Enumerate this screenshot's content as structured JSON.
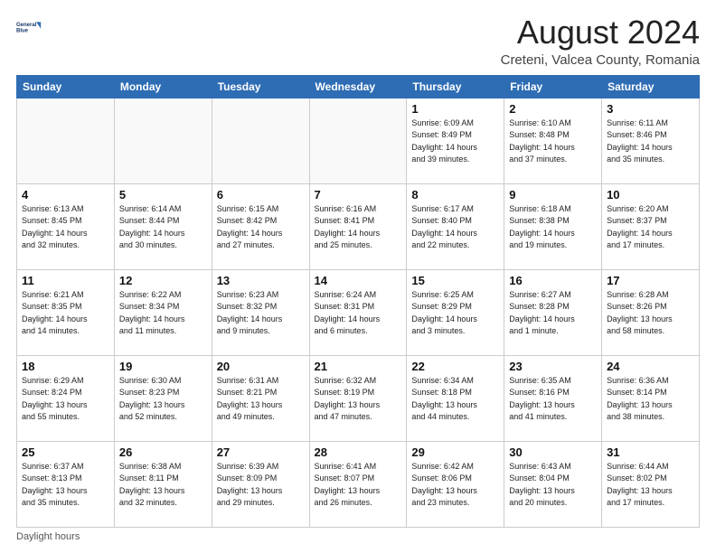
{
  "logo": {
    "line1": "General",
    "line2": "Blue"
  },
  "title": "August 2024",
  "subtitle": "Creteni, Valcea County, Romania",
  "weekdays": [
    "Sunday",
    "Monday",
    "Tuesday",
    "Wednesday",
    "Thursday",
    "Friday",
    "Saturday"
  ],
  "weeks": [
    [
      {
        "day": "",
        "info": ""
      },
      {
        "day": "",
        "info": ""
      },
      {
        "day": "",
        "info": ""
      },
      {
        "day": "",
        "info": ""
      },
      {
        "day": "1",
        "info": "Sunrise: 6:09 AM\nSunset: 8:49 PM\nDaylight: 14 hours\nand 39 minutes."
      },
      {
        "day": "2",
        "info": "Sunrise: 6:10 AM\nSunset: 8:48 PM\nDaylight: 14 hours\nand 37 minutes."
      },
      {
        "day": "3",
        "info": "Sunrise: 6:11 AM\nSunset: 8:46 PM\nDaylight: 14 hours\nand 35 minutes."
      }
    ],
    [
      {
        "day": "4",
        "info": "Sunrise: 6:13 AM\nSunset: 8:45 PM\nDaylight: 14 hours\nand 32 minutes."
      },
      {
        "day": "5",
        "info": "Sunrise: 6:14 AM\nSunset: 8:44 PM\nDaylight: 14 hours\nand 30 minutes."
      },
      {
        "day": "6",
        "info": "Sunrise: 6:15 AM\nSunset: 8:42 PM\nDaylight: 14 hours\nand 27 minutes."
      },
      {
        "day": "7",
        "info": "Sunrise: 6:16 AM\nSunset: 8:41 PM\nDaylight: 14 hours\nand 25 minutes."
      },
      {
        "day": "8",
        "info": "Sunrise: 6:17 AM\nSunset: 8:40 PM\nDaylight: 14 hours\nand 22 minutes."
      },
      {
        "day": "9",
        "info": "Sunrise: 6:18 AM\nSunset: 8:38 PM\nDaylight: 14 hours\nand 19 minutes."
      },
      {
        "day": "10",
        "info": "Sunrise: 6:20 AM\nSunset: 8:37 PM\nDaylight: 14 hours\nand 17 minutes."
      }
    ],
    [
      {
        "day": "11",
        "info": "Sunrise: 6:21 AM\nSunset: 8:35 PM\nDaylight: 14 hours\nand 14 minutes."
      },
      {
        "day": "12",
        "info": "Sunrise: 6:22 AM\nSunset: 8:34 PM\nDaylight: 14 hours\nand 11 minutes."
      },
      {
        "day": "13",
        "info": "Sunrise: 6:23 AM\nSunset: 8:32 PM\nDaylight: 14 hours\nand 9 minutes."
      },
      {
        "day": "14",
        "info": "Sunrise: 6:24 AM\nSunset: 8:31 PM\nDaylight: 14 hours\nand 6 minutes."
      },
      {
        "day": "15",
        "info": "Sunrise: 6:25 AM\nSunset: 8:29 PM\nDaylight: 14 hours\nand 3 minutes."
      },
      {
        "day": "16",
        "info": "Sunrise: 6:27 AM\nSunset: 8:28 PM\nDaylight: 14 hours\nand 1 minute."
      },
      {
        "day": "17",
        "info": "Sunrise: 6:28 AM\nSunset: 8:26 PM\nDaylight: 13 hours\nand 58 minutes."
      }
    ],
    [
      {
        "day": "18",
        "info": "Sunrise: 6:29 AM\nSunset: 8:24 PM\nDaylight: 13 hours\nand 55 minutes."
      },
      {
        "day": "19",
        "info": "Sunrise: 6:30 AM\nSunset: 8:23 PM\nDaylight: 13 hours\nand 52 minutes."
      },
      {
        "day": "20",
        "info": "Sunrise: 6:31 AM\nSunset: 8:21 PM\nDaylight: 13 hours\nand 49 minutes."
      },
      {
        "day": "21",
        "info": "Sunrise: 6:32 AM\nSunset: 8:19 PM\nDaylight: 13 hours\nand 47 minutes."
      },
      {
        "day": "22",
        "info": "Sunrise: 6:34 AM\nSunset: 8:18 PM\nDaylight: 13 hours\nand 44 minutes."
      },
      {
        "day": "23",
        "info": "Sunrise: 6:35 AM\nSunset: 8:16 PM\nDaylight: 13 hours\nand 41 minutes."
      },
      {
        "day": "24",
        "info": "Sunrise: 6:36 AM\nSunset: 8:14 PM\nDaylight: 13 hours\nand 38 minutes."
      }
    ],
    [
      {
        "day": "25",
        "info": "Sunrise: 6:37 AM\nSunset: 8:13 PM\nDaylight: 13 hours\nand 35 minutes."
      },
      {
        "day": "26",
        "info": "Sunrise: 6:38 AM\nSunset: 8:11 PM\nDaylight: 13 hours\nand 32 minutes."
      },
      {
        "day": "27",
        "info": "Sunrise: 6:39 AM\nSunset: 8:09 PM\nDaylight: 13 hours\nand 29 minutes."
      },
      {
        "day": "28",
        "info": "Sunrise: 6:41 AM\nSunset: 8:07 PM\nDaylight: 13 hours\nand 26 minutes."
      },
      {
        "day": "29",
        "info": "Sunrise: 6:42 AM\nSunset: 8:06 PM\nDaylight: 13 hours\nand 23 minutes."
      },
      {
        "day": "30",
        "info": "Sunrise: 6:43 AM\nSunset: 8:04 PM\nDaylight: 13 hours\nand 20 minutes."
      },
      {
        "day": "31",
        "info": "Sunrise: 6:44 AM\nSunset: 8:02 PM\nDaylight: 13 hours\nand 17 minutes."
      }
    ]
  ],
  "footer": {
    "daylight_label": "Daylight hours"
  }
}
